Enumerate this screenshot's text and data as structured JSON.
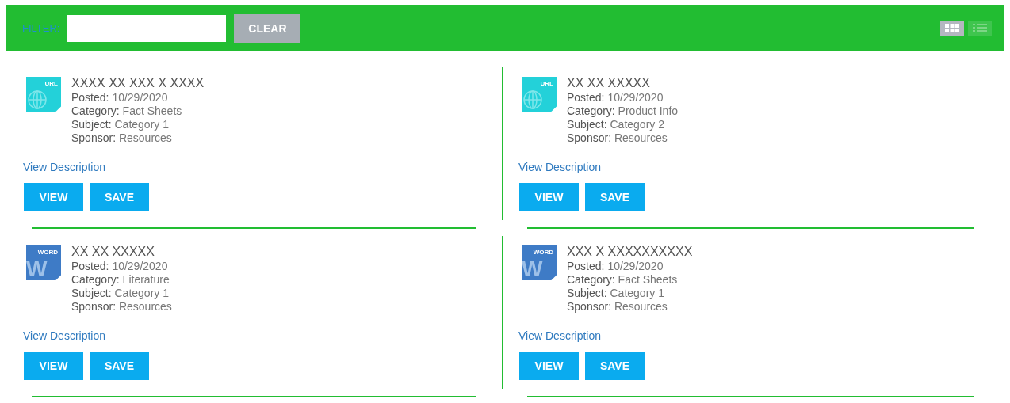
{
  "toolbar": {
    "filter_label": "FILTER:",
    "clear_button": "CLEAR",
    "views": [
      {
        "kind": "grid",
        "selected": true
      },
      {
        "kind": "list",
        "selected": false
      }
    ]
  },
  "documents": [
    {
      "kind": "url",
      "icon_label": "URL",
      "title": "XXXX XX XXX X XXXX",
      "details": [
        {
          "label": "Posted:",
          "value": "10/29/2020"
        },
        {
          "label": "Category:",
          "value": "Fact Sheets"
        },
        {
          "label": "Subject:",
          "value": "Category 1"
        },
        {
          "label": "Sponsor:",
          "value": "Resources"
        }
      ],
      "link": "View Description",
      "buttons": [
        "VIEW",
        "SAVE"
      ]
    },
    {
      "kind": "url",
      "icon_label": "URL",
      "title": "XX XX XXXXX",
      "details": [
        {
          "label": "Posted:",
          "value": "10/29/2020"
        },
        {
          "label": "Category:",
          "value": "Product Info"
        },
        {
          "label": "Subject:",
          "value": "Category 2"
        },
        {
          "label": "Sponsor:",
          "value": "Resources"
        }
      ],
      "link": "View Description",
      "buttons": [
        "VIEW",
        "SAVE"
      ]
    },
    {
      "kind": "word",
      "icon_label": "WORD",
      "icon_letter": "W",
      "title": "XX XX XXXXX",
      "details": [
        {
          "label": "Posted:",
          "value": "10/29/2020"
        },
        {
          "label": "Category:",
          "value": "Literature"
        },
        {
          "label": "Subject:",
          "value": "Category 1"
        },
        {
          "label": "Sponsor:",
          "value": "Resources"
        }
      ],
      "link": "View Description",
      "buttons": [
        "VIEW",
        "SAVE"
      ]
    },
    {
      "kind": "word",
      "icon_label": "WORD",
      "icon_letter": "W",
      "title": "XXX X XXXXXXXXXX",
      "details": [
        {
          "label": "Posted:",
          "value": "10/29/2020"
        },
        {
          "label": "Category:",
          "value": "Fact Sheets"
        },
        {
          "label": "Subject:",
          "value": "Category 1"
        },
        {
          "label": "Sponsor:",
          "value": "Resources"
        }
      ],
      "link": "View Description",
      "buttons": [
        "VIEW",
        "SAVE"
      ]
    }
  ]
}
